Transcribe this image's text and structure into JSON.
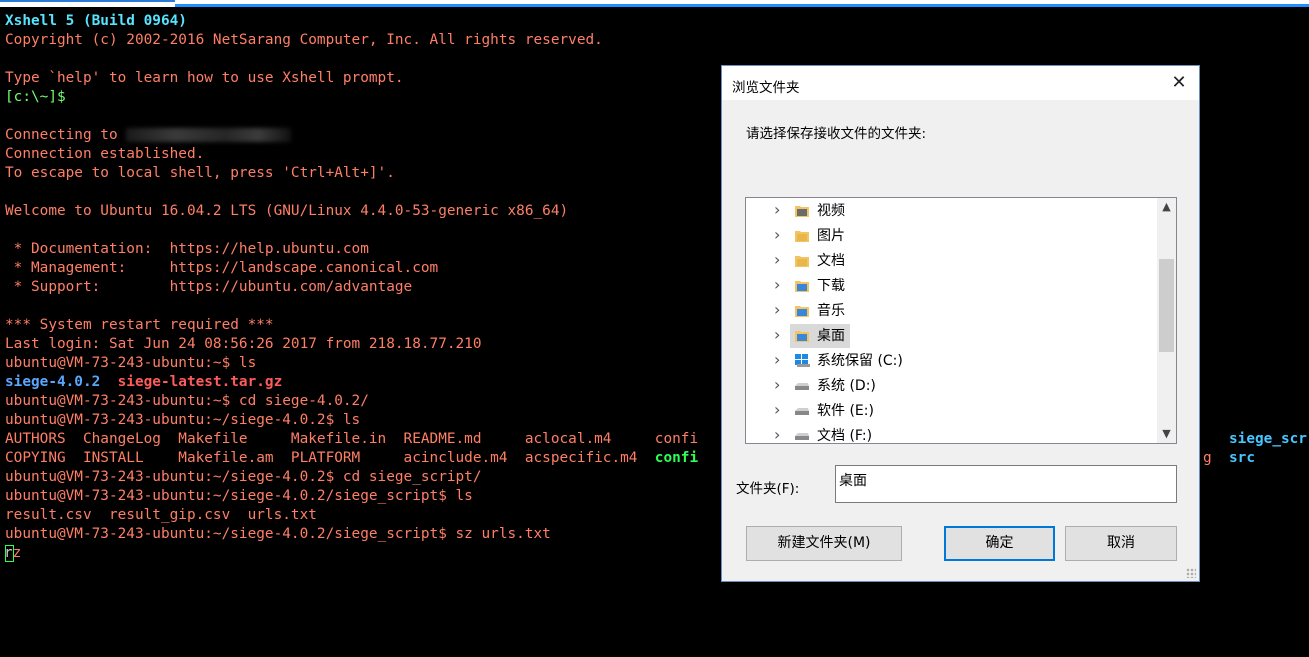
{
  "terminal": {
    "lines": [
      "Xshell 5 (Build 0964)",
      "Copyright (c) 2002-2016 NetSarang Computer, Inc. All rights reserved.",
      "",
      "Type `help' to learn how to use Xshell prompt.",
      "[c:\\~]$",
      "",
      "Connecting to ",
      "Connection established.",
      "To escape to local shell, press 'Ctrl+Alt+]'.",
      "",
      "Welcome to Ubuntu 16.04.2 LTS (GNU/Linux 4.4.0-53-generic x86_64)",
      "",
      " * Documentation:  https://help.ubuntu.com",
      " * Management:     https://landscape.canonical.com",
      " * Support:        https://ubuntu.com/advantage",
      "",
      "*** System restart required ***",
      "Last login: Sat Jun 24 08:56:26 2017 from 218.18.77.210",
      "ubuntu@VM-73-243-ubuntu:~$ ls",
      "",
      "ubuntu@VM-73-243-ubuntu:~$ cd siege-4.0.2/",
      "ubuntu@VM-73-243-ubuntu:~/siege-4.0.2$ ls",
      "AUTHORS  ChangeLog  Makefile     Makefile.in  README.md     aclocal.m4     confi",
      "COPYING  INSTALL    Makefile.am  PLATFORM     acinclude.m4  acspecific.m4  ",
      "ubuntu@VM-73-243-ubuntu:~/siege-4.0.2$ cd siege_script/",
      "ubuntu@VM-73-243-ubuntu:~/siege-4.0.2/siege_script$ ls",
      "result.csv  result_gip.csv  urls.txt",
      "ubuntu@VM-73-243-ubuntu:~/siege-4.0.2/siege_script$ sz urls.txt",
      "z"
    ],
    "ls_dir": "siege-4.0.2",
    "ls_archive": "siege-latest.tar.gz",
    "confi_green": "confi",
    "right_siege_scr": "siege_scr",
    "right_g": "g",
    "right_src": "src",
    "cursor_char": "r"
  },
  "dialog": {
    "title": "浏览文件夹",
    "close_glyph": "✕",
    "instruction": "请选择保存接收文件的文件夹:",
    "tree_items": [
      {
        "label": "视频",
        "icon": "video-folder-icon",
        "color": "#6b6b6b"
      },
      {
        "label": "图片",
        "icon": "pictures-folder-icon",
        "color": "#e8b64a"
      },
      {
        "label": "文档",
        "icon": "documents-folder-icon",
        "color": "#e8b64a"
      },
      {
        "label": "下载",
        "icon": "downloads-folder-icon",
        "color": "#3a86d8"
      },
      {
        "label": "音乐",
        "icon": "music-folder-icon",
        "color": "#3a86d8"
      },
      {
        "label": "桌面",
        "icon": "desktop-folder-icon",
        "color": "#3a86d8",
        "selected": true
      },
      {
        "label": "系统保留 (C:)",
        "icon": "windows-drive-icon",
        "color": "#2b8fe0"
      },
      {
        "label": "系统 (D:)",
        "icon": "drive-icon",
        "color": "#888888"
      },
      {
        "label": "软件 (E:)",
        "icon": "drive-icon",
        "color": "#888888"
      },
      {
        "label": "文档 (F:)",
        "icon": "drive-icon",
        "color": "#888888"
      }
    ],
    "folder_label": "文件夹(F):",
    "folder_value": "桌面",
    "new_folder_button": "新建文件夹(M)",
    "ok_button": "确定",
    "cancel_button": "取消"
  }
}
